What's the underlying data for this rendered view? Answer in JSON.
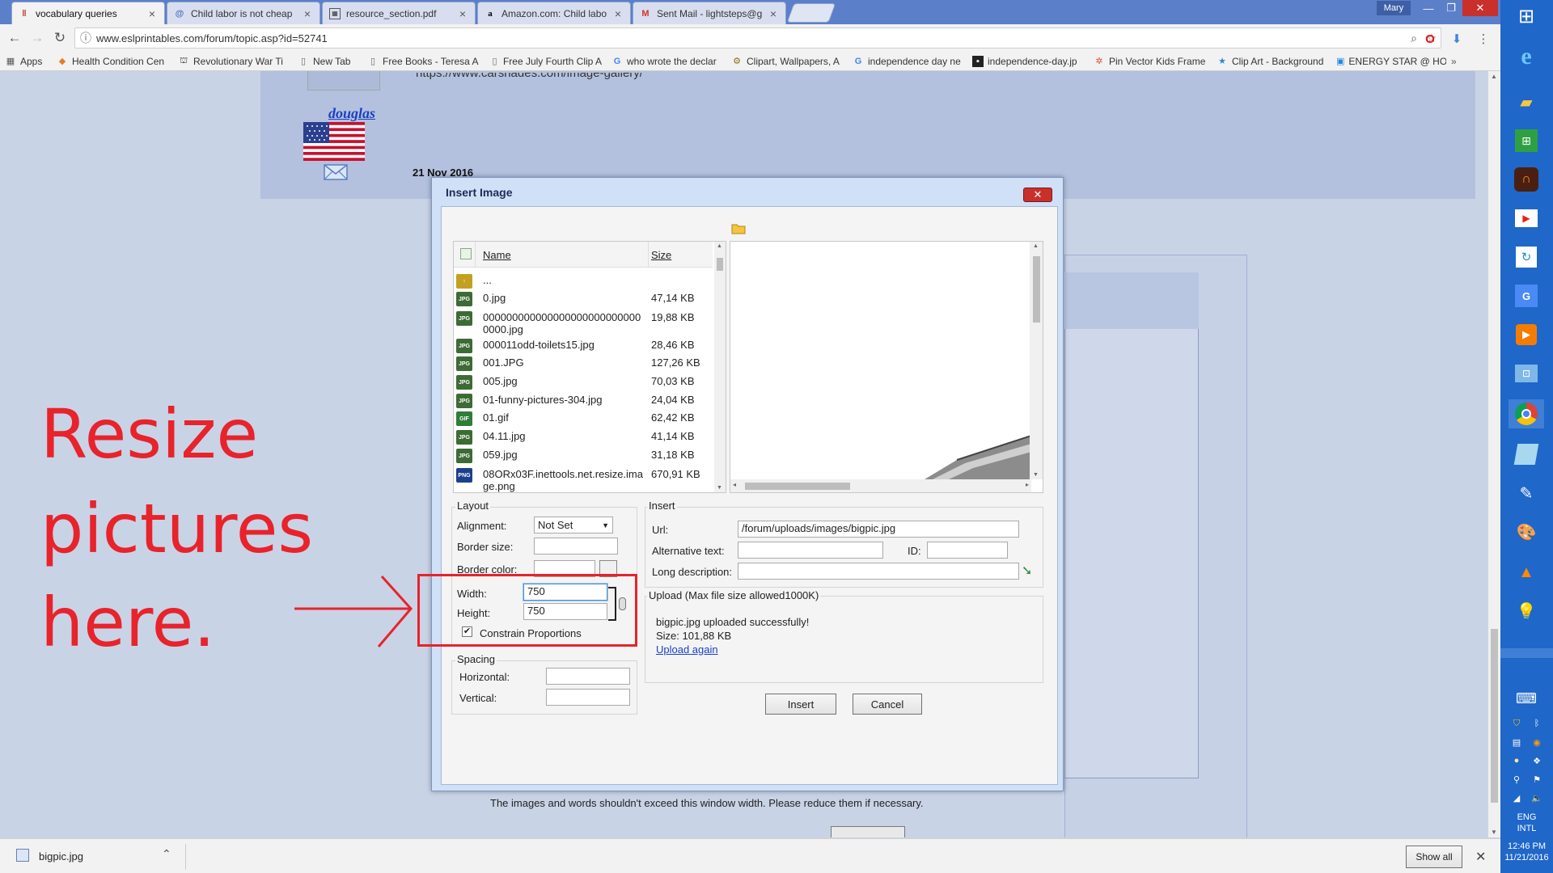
{
  "browser": {
    "tabs": [
      {
        "title": "vocabulary queries",
        "icon": "eslprintables-favicon",
        "active": true
      },
      {
        "title": "Child labor is not cheap",
        "icon": "swirl-favicon"
      },
      {
        "title": "resource_section.pdf",
        "icon": "pdf-favicon"
      },
      {
        "title": "Amazon.com: Child labo",
        "icon": "amazon-favicon"
      },
      {
        "title": "Sent Mail - lightsteps@g",
        "icon": "gmail-favicon"
      }
    ],
    "profile": "Mary",
    "address": "www.eslprintables.com/forum/topic.asp?id=52741",
    "bookmarks": [
      {
        "label": "Apps",
        "icon": "apps-grid-icon"
      },
      {
        "label": "Health Condition Cen",
        "icon": "health-icon"
      },
      {
        "label": "Revolutionary War Ti",
        "icon": "bookmark-icon"
      },
      {
        "label": "New Tab",
        "icon": "page-icon"
      },
      {
        "label": "Free Books - Teresa A",
        "icon": "page-icon"
      },
      {
        "label": "Free July Fourth Clip A",
        "icon": "page-icon"
      },
      {
        "label": "who wrote the declar",
        "icon": "google-icon"
      },
      {
        "label": "Clipart, Wallpapers, A",
        "icon": "gear-icon"
      },
      {
        "label": "independence day ne",
        "icon": "google-icon"
      },
      {
        "label": "independence-day.jp",
        "icon": "image-icon"
      },
      {
        "label": "Pin Vector Kids Frame",
        "icon": "pinwheel-icon"
      },
      {
        "label": "Clip Art - Background",
        "icon": "star-icon"
      },
      {
        "label": "ENERGY STAR @ HO",
        "icon": "energy-star-icon"
      }
    ]
  },
  "page": {
    "url_fragment": "https://www.carshades.com/image-gallery/",
    "username": "douglas",
    "post_date": "21 Nov 2016",
    "warning": "The images and words shouldn't exceed this window width. Please reduce them if necessary."
  },
  "annotation": {
    "lines": [
      "Resize",
      "pictures",
      "here."
    ],
    "color": "#e8232b"
  },
  "dialog": {
    "title": "Insert Image",
    "columns": {
      "name": "Name",
      "size": "Size"
    },
    "files": [
      {
        "name": "...",
        "size": "",
        "type": "up"
      },
      {
        "name": "0.jpg",
        "size": "47,14 KB",
        "type": "JPG"
      },
      {
        "name": "0000000000000000000000000000000.jpg",
        "size": "19,88 KB",
        "type": "JPG"
      },
      {
        "name": "000011odd-toilets15.jpg",
        "size": "28,46 KB",
        "type": "JPG"
      },
      {
        "name": "001.JPG",
        "size": "127,26 KB",
        "type": "JPG"
      },
      {
        "name": "005.jpg",
        "size": "70,03 KB",
        "type": "JPG"
      },
      {
        "name": "01-funny-pictures-304.jpg",
        "size": "24,04 KB",
        "type": "JPG"
      },
      {
        "name": "01.gif",
        "size": "62,42 KB",
        "type": "GIF"
      },
      {
        "name": "04.11.jpg",
        "size": "41,14 KB",
        "type": "JPG"
      },
      {
        "name": "059.jpg",
        "size": "31,18 KB",
        "type": "JPG"
      },
      {
        "name": "08ORx03F.inettools.net.resize.image.png",
        "size": "670,91 KB",
        "type": "PNG"
      }
    ],
    "layout": {
      "legend": "Layout",
      "alignment_label": "Alignment:",
      "alignment_value": "Not Set",
      "border_size_label": "Border size:",
      "border_color_label": "Border color:",
      "width_label": "Width:",
      "width_value": "750",
      "height_label": "Height:",
      "height_value": "750",
      "constrain_label": "Constrain Proportions",
      "constrain_checked": true
    },
    "spacing": {
      "legend": "Spacing",
      "horizontal_label": "Horizontal:",
      "vertical_label": "Vertical:"
    },
    "insert": {
      "legend": "Insert",
      "url_label": "Url:",
      "url_value": "/forum/uploads/images/bigpic.jpg",
      "alt_label": "Alternative text:",
      "id_label": "ID:",
      "longdesc_label": "Long description:"
    },
    "upload": {
      "legend": "Upload (Max file size allowed1000K)",
      "message": "bigpic.jpg uploaded successfully!",
      "size": "Size: 101,88 KB",
      "again": "Upload again"
    },
    "buttons": {
      "insert": "Insert",
      "cancel": "Cancel"
    }
  },
  "downloads": {
    "file": "bigpic.jpg",
    "show_all": "Show all"
  },
  "taskbar": {
    "lang1": "ENG",
    "lang2": "INTL",
    "time": "12:46 PM",
    "date": "11/21/2016"
  }
}
